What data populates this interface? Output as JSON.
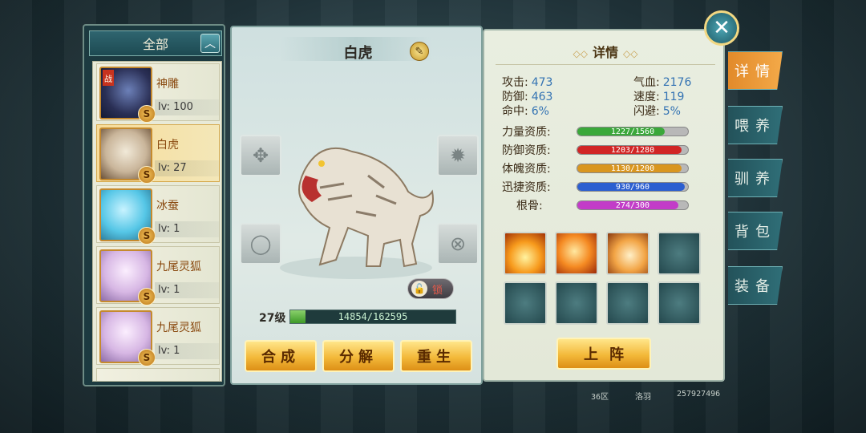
{
  "list": {
    "header": "全部",
    "items": [
      {
        "name": "神雕",
        "level": "lv: 100",
        "badge": "S",
        "tag": "战"
      },
      {
        "name": "白虎",
        "level": "lv: 27",
        "badge": "S"
      },
      {
        "name": "冰蚕",
        "level": "lv: 1",
        "badge": "S"
      },
      {
        "name": "九尾灵狐",
        "level": "lv: 1",
        "badge": "S"
      },
      {
        "name": "九尾灵狐",
        "level": "lv: 1",
        "badge": "S"
      }
    ]
  },
  "center": {
    "pet_name": "白虎",
    "lock_label": "锁",
    "level_label": "27级",
    "exp_text": "14854/162595",
    "exp_fraction": 0.0914,
    "buttons": {
      "merge": "合成",
      "split": "分解",
      "rebirth": "重生"
    }
  },
  "details": {
    "title": "详情",
    "stats": {
      "attack_label": "攻击:",
      "attack": "473",
      "hp_label": "气血:",
      "hp": "2176",
      "defense_label": "防御:",
      "defense": "463",
      "speed_label": "速度:",
      "speed": "119",
      "hit_label": "命中:",
      "hit": "6%",
      "dodge_label": "闪避:",
      "dodge": "5%"
    },
    "aptitudes": [
      {
        "label": "力量资质:",
        "text": "1227/1560",
        "fraction": 0.787,
        "color": "#3aa83a"
      },
      {
        "label": "防御资质:",
        "text": "1203/1280",
        "fraction": 0.94,
        "color": "#d12525"
      },
      {
        "label": "体魄资质:",
        "text": "1130/1200",
        "fraction": 0.942,
        "color": "#d9961f"
      },
      {
        "label": "迅捷资质:",
        "text": "930/960",
        "fraction": 0.969,
        "color": "#2c5fd0"
      },
      {
        "label": "根骨:",
        "text": "274/300",
        "fraction": 0.913,
        "color": "#c23cc8"
      }
    ],
    "deploy_label": "上阵"
  },
  "tabs": [
    "详情",
    "喂养",
    "驯养",
    "背包",
    "装备"
  ],
  "footer": {
    "server": "36区",
    "player": "洛羽",
    "id": "257927496"
  }
}
